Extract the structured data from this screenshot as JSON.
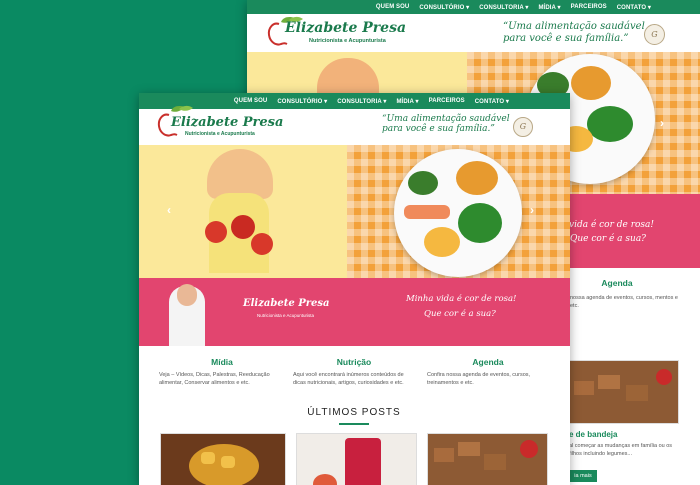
{
  "nav": {
    "items": [
      "QUEM SOU",
      "CONSULTÓRIO ▾",
      "CONSULTORIA ▾",
      "MÍDIA ▾",
      "PARCEIROS",
      "CONTATO ▾"
    ]
  },
  "brand": {
    "name": "Elizabete Presa",
    "subtitle": "Nutricionista e Acupunturista",
    "tagline_line1": "“Uma alimentação saudável",
    "tagline_line2": "para você e sua família.”"
  },
  "banner": {
    "name": "Elizabete Presa",
    "subtitle": "Nutricionista e Acupunturista",
    "quote_line1": "Minha vida é cor de rosa!",
    "quote_line2": "Que cor é a sua?"
  },
  "back_banner": {
    "quote_line1": "vida é cor de rosa!",
    "quote_line2": "Que cor é a sua?"
  },
  "columns": [
    {
      "title": "Mídia",
      "text": "Veja – Vídeos, Dicas, Palestras, Reeducação alimentar, Conservar alimentos e etc."
    },
    {
      "title": "Nutrição",
      "text": "Aqui você encontrará inúmeros conteúdos de dicas nutricionais, artigos, curiosidades e etc."
    },
    {
      "title": "Agenda",
      "text": "Confira nossa agenda de eventos, cursos, treinamentos e etc."
    }
  ],
  "back_column": {
    "title": "Agenda",
    "text": "nossa agenda de eventos, cursos, mentos e etc."
  },
  "posts": {
    "title": "ÚLTIMOS POSTS"
  },
  "back_post": {
    "title": "e de bandeja",
    "text": "al começar as mudanças em família ou os filhos incluindo legumes...",
    "button": "ia mais"
  },
  "seal_text": "G",
  "colors": {
    "green": "#1a8a5c",
    "pink": "#e2456f",
    "orange": "#f3a13a",
    "background": "#0a8a62"
  }
}
